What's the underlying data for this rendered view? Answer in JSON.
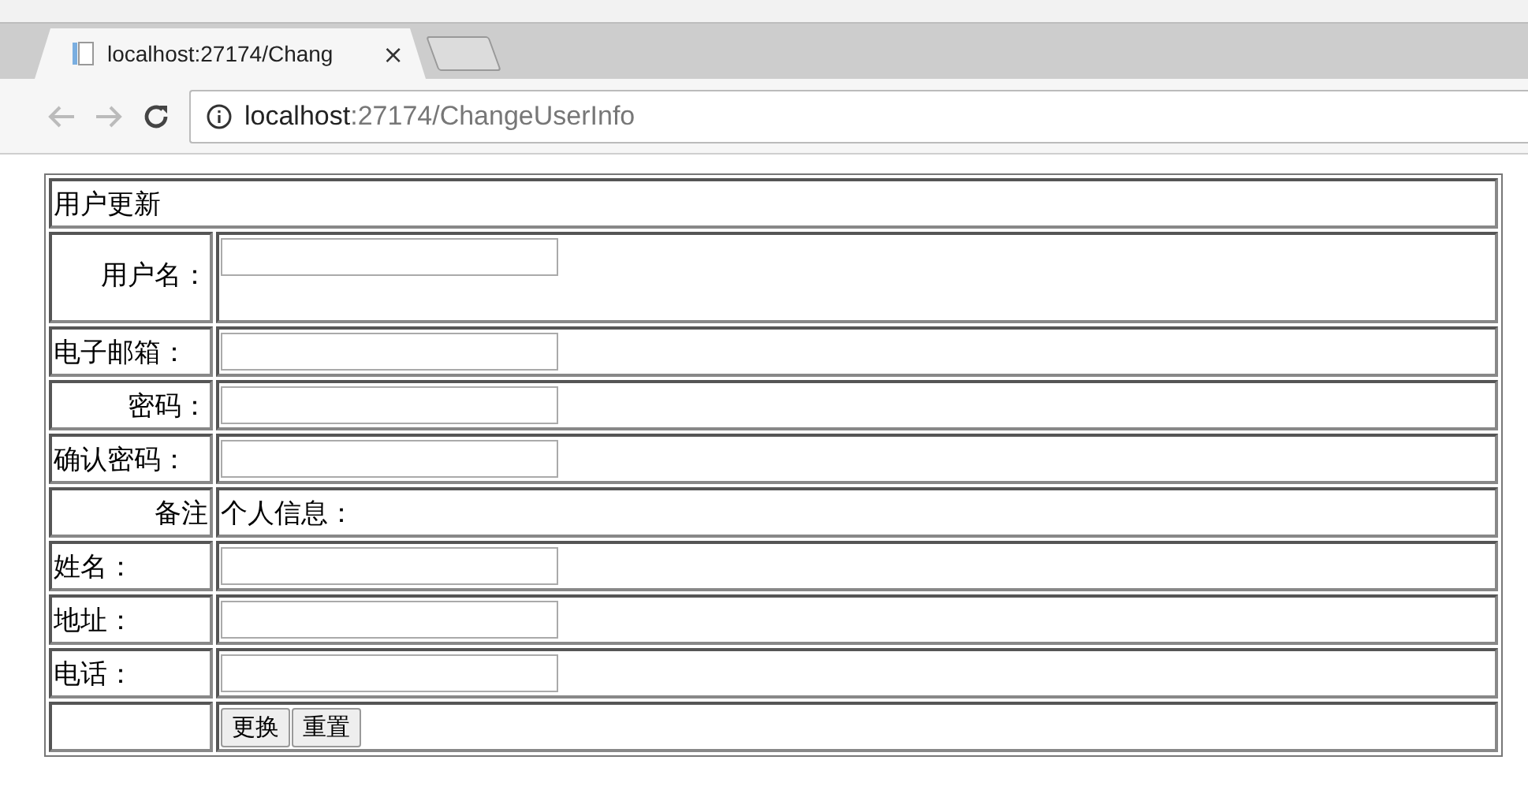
{
  "browser": {
    "tab_title": "localhost:27174/Chang",
    "tab_close": "×",
    "address_host": "localhost",
    "address_rest": ":27174/ChangeUserInfo"
  },
  "form": {
    "title": "用户更新",
    "rows": [
      {
        "kind": "field",
        "label": "用户名：",
        "right_aligned": true,
        "tall": true
      },
      {
        "kind": "field",
        "label": "电子邮箱：",
        "right_aligned": false,
        "tall": false
      },
      {
        "kind": "field",
        "label": "密码：",
        "right_aligned": true,
        "tall": false
      },
      {
        "kind": "field",
        "label": "确认密码：",
        "right_aligned": false,
        "tall": false
      },
      {
        "kind": "text",
        "label": "备注",
        "right_aligned": true,
        "text": "个人信息："
      },
      {
        "kind": "field",
        "label": "姓名：",
        "right_aligned": false,
        "tall": false
      },
      {
        "kind": "field",
        "label": "地址：",
        "right_aligned": false,
        "tall": false
      },
      {
        "kind": "field",
        "label": "电话：",
        "right_aligned": false,
        "tall": false
      },
      {
        "kind": "buttons",
        "buttons": [
          "更换",
          "重置"
        ]
      }
    ]
  }
}
